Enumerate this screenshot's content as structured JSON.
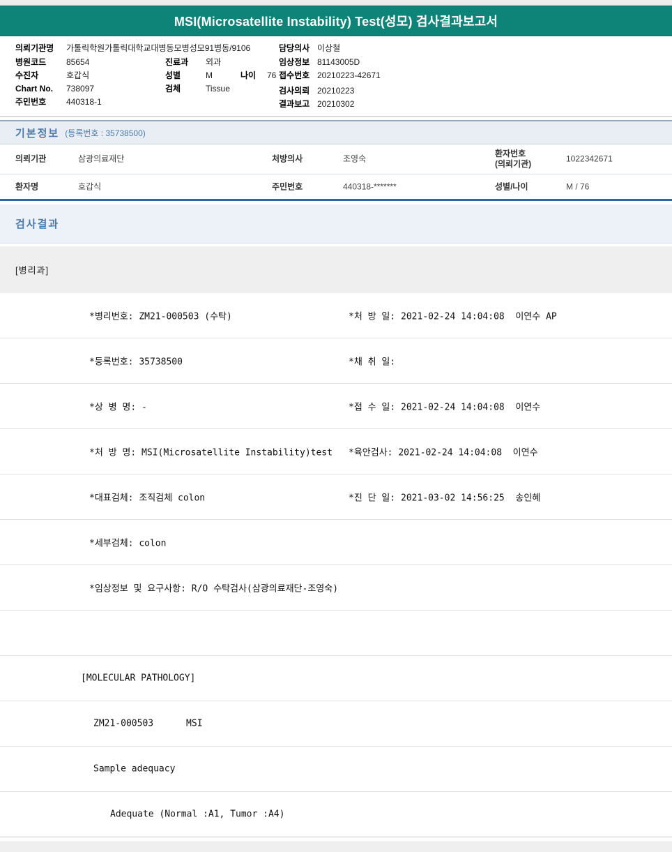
{
  "title": "MSI(Microsatellite Instability) Test(성모) 검사결과보고서",
  "colors": {
    "header_teal": "#0E8478",
    "section_blue": "#4d7aa8",
    "thick_border_blue": "#2c66a3",
    "band_gray": "#efefef",
    "band_blue_bg": "#edf2f8"
  },
  "patient_header": {
    "col1": [
      {
        "label": "의뢰기관명",
        "value": "가톨릭학원가톨릭대학교대병동모병성모91병동/9106"
      },
      {
        "label": "병원코드",
        "value": "85654"
      },
      {
        "label": "수진자",
        "value": "호갑식"
      },
      {
        "label": "Chart No.",
        "value": "738097"
      },
      {
        "label": "주민번호",
        "value": "440318-1"
      }
    ],
    "col2": [
      {
        "label": "진료과",
        "value": "외과"
      },
      {
        "label": "성별",
        "value": "M",
        "label2": "나이",
        "value2": "76"
      },
      {
        "label": "검체",
        "value": "Tissue"
      }
    ],
    "col3": [
      {
        "label": "담당의사",
        "value": "이상철"
      },
      {
        "label": "임상정보",
        "value": "81143005D"
      },
      {
        "label": "접수번호",
        "value": "20210223-42671"
      },
      {
        "label": "검사의뢰",
        "value": "20210223"
      },
      {
        "label": "결과보고",
        "value": "20210302"
      }
    ]
  },
  "basic_info": {
    "section_title": "기본정보",
    "reg_label": "(등록번호 : 35738500)",
    "rows": [
      {
        "cells": [
          {
            "label": "의뢰기관",
            "value": "삼광의료재단"
          },
          {
            "label": "처방의사",
            "value": "조영숙"
          },
          {
            "label": "환자번호\n(의뢰기관)",
            "value": "1022342671"
          }
        ]
      },
      {
        "cells": [
          {
            "label": "환자명",
            "value": "호갑식"
          },
          {
            "label": "주민번호",
            "value": "440318-*******"
          },
          {
            "label": "성별/나이",
            "value": "M / 76"
          }
        ]
      }
    ]
  },
  "result_section": {
    "title": "검사결과",
    "department": "[병리과]",
    "rows": [
      {
        "left": "*병리번호: ZM21-000503 (수탁)",
        "right": "*처 방 일: 2021-02-24 14:04:08  이연수 AP"
      },
      {
        "left": "*등록번호: 35738500",
        "right": "*채 취 일:"
      },
      {
        "left": "*상 병 명: -",
        "right": "*접 수 일: 2021-02-24 14:04:08  이연수"
      },
      {
        "left": "*처 방 명: MSI(Microsatellite Instability)test",
        "right": "*육안검사: 2021-02-24 14:04:08  이연수"
      },
      {
        "left": "*대표검체: 조직검체 colon",
        "right": "*진 단 일: 2021-03-02 14:56:25  송인혜"
      },
      {
        "left": "*세부검체: colon",
        "right": ""
      },
      {
        "left": "*임상정보 및 요구사항: R/O 수탁검사(삼광의료재단-조영숙)",
        "right": ""
      },
      {
        "left": "",
        "right": ""
      },
      {
        "left": "[MOLECULAR PATHOLOGY]",
        "right": ""
      },
      {
        "left": "ZM21-000503      MSI",
        "right": ""
      },
      {
        "left": "Sample adequacy",
        "right": ""
      },
      {
        "left": "Adequate (Normal :A1, Tumor :A4)",
        "right": ""
      }
    ]
  }
}
